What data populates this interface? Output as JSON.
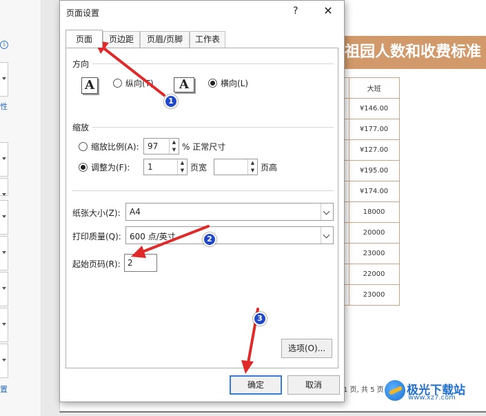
{
  "background": {
    "side_texts": [
      "性",
      "置"
    ],
    "sheet_title": "祖园人数和收费标准",
    "table_header": "大班",
    "table_values": [
      "¥146.00",
      "¥177.00",
      "¥127.00",
      "¥195.00",
      "¥174.00",
      "18000",
      "20000",
      "23000",
      "22000",
      "23000"
    ],
    "page_footer": "1 页, 共 5 页",
    "watermark_title": "极光下载站",
    "watermark_url": "www.xz7.com"
  },
  "dialog": {
    "title": "页面设置",
    "help": "?",
    "close": "✕",
    "tabs": [
      "页面",
      "页边距",
      "页眉/页脚",
      "工作表"
    ],
    "orientation": {
      "label": "方向",
      "icon_glyph": "A",
      "portrait": "纵向(T)",
      "landscape": "横向(L)",
      "selected": "landscape"
    },
    "scaling": {
      "label": "缩放",
      "ratio_label": "缩放比例(A):",
      "ratio_value": "97",
      "ratio_suffix": "% 正常尺寸",
      "fit_label": "调整为(F):",
      "fit_wide_value": "1",
      "fit_wide_suffix": "页宽",
      "fit_tall_value": "",
      "fit_tall_suffix": "页高",
      "selected": "fit"
    },
    "paper_size_label": "纸张大小(Z):",
    "paper_size_value": "A4",
    "print_quality_label": "打印质量(Q):",
    "print_quality_value": "600 点/英寸",
    "first_page_label": "起始页码(R):",
    "first_page_value": "2",
    "options_button": "选项(O)...",
    "ok_button": "确定",
    "cancel_button": "取消"
  },
  "annotations": {
    "badge_1": "1",
    "badge_2": "2",
    "badge_3": "3",
    "arrow_color": "#e02a2a",
    "badge_color": "#2048c8"
  }
}
